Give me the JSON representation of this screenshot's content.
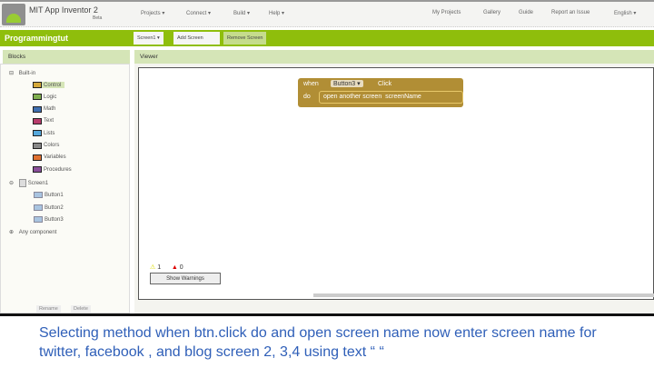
{
  "header": {
    "app_title": "MIT App Inventor 2",
    "beta": "Beta",
    "menus": [
      "Projects ▾",
      "Connect ▾",
      "Build ▾",
      "Help ▾"
    ],
    "right_links": [
      "My Projects",
      "Gallery",
      "Guide",
      "Report an Issue",
      "English ▾"
    ]
  },
  "toolbar": {
    "project": "Programmingtut",
    "screen_select": "Screen1 ▾",
    "add_screen": "Add Screen",
    "remove_screen": "Remove Screen"
  },
  "blocks_panel": {
    "title": "Blocks",
    "built_in": "Built-in",
    "categories": [
      {
        "label": "Control",
        "color": "#d4a83a"
      },
      {
        "label": "Logic",
        "color": "#7fae4f"
      },
      {
        "label": "Math",
        "color": "#3f6fb0"
      },
      {
        "label": "Text",
        "color": "#b83c6c"
      },
      {
        "label": "Lists",
        "color": "#55a8dc"
      },
      {
        "label": "Colors",
        "color": "#888888"
      },
      {
        "label": "Variables",
        "color": "#e07030"
      },
      {
        "label": "Procedures",
        "color": "#8a4f9a"
      }
    ],
    "screen": "Screen1",
    "components": [
      "Button1",
      "Button2",
      "Button3"
    ],
    "any_component": "Any component",
    "rename": "Rename",
    "delete": "Delete"
  },
  "viewer": {
    "title": "Viewer",
    "block": {
      "when": "when",
      "component": "Button3 ▾",
      "event": "Click",
      "do": "do",
      "call": "open another screen",
      "param": "screenName"
    },
    "warnings_count": "1",
    "errors_count": "0",
    "show_warnings": "Show Warnings"
  },
  "caption": "Selecting method when btn.click do and open screen name now enter screen name for twitter, facebook , and blog screen 2, 3,4 using text “ “"
}
